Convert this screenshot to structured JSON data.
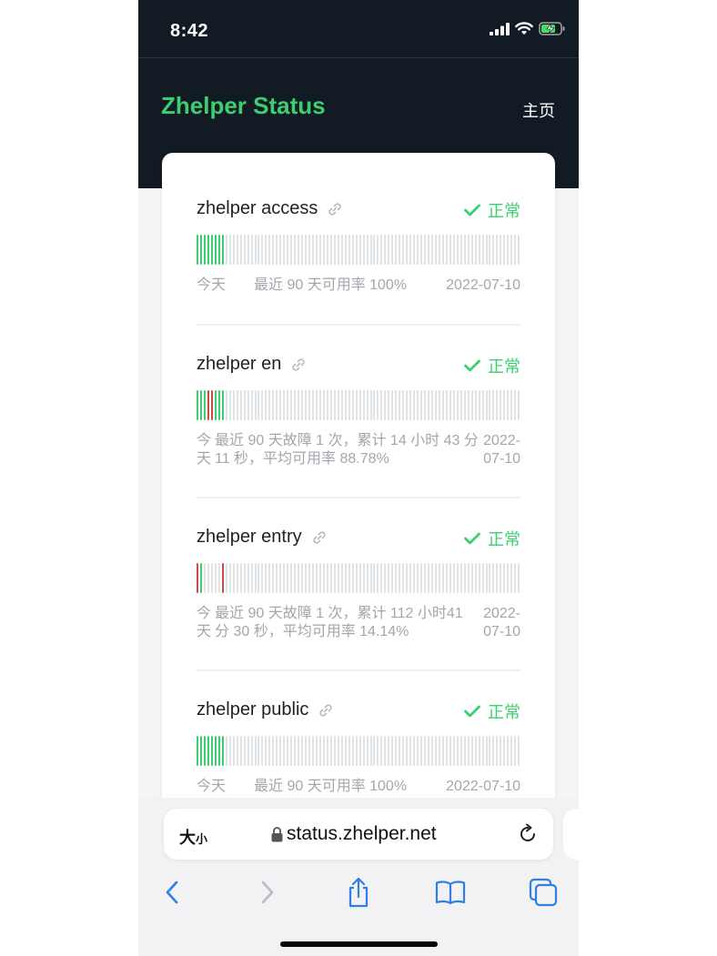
{
  "status_bar": {
    "time": "8:42"
  },
  "header": {
    "title": "Zhelper Status",
    "nav_home": "主页"
  },
  "colors": {
    "up": "#3ccf6f",
    "down": "#c94b4b",
    "empty": "#e0e3e6",
    "header_bg": "#121a24"
  },
  "monitors": [
    {
      "name": "zhelper access",
      "status": "正常",
      "day_states": [
        "up",
        "up",
        "up",
        "up",
        "up",
        "up",
        "up",
        "up"
      ],
      "today_label": "今天",
      "summary": "最近 90 天可用率 100%",
      "date": "2022-07-10"
    },
    {
      "name": "zhelper en",
      "status": "正常",
      "day_states": [
        "up",
        "up",
        "up",
        "down",
        "down",
        "up",
        "up",
        "up"
      ],
      "today_label": "今天",
      "summary": "最近 90 天故障 1 次，累计 14 小时 43 分 11 秒，平均可用率 88.78%",
      "date": "2022-07-10"
    },
    {
      "name": "zhelper entry",
      "status": "正常",
      "day_states": [
        "down",
        "up",
        "empty",
        "empty",
        "empty",
        "empty",
        "empty",
        "down"
      ],
      "today_label": "今天",
      "summary": "最近 90 天故障 1 次，累计 112 小时41 分 30 秒，平均可用率 14.14%",
      "date": "2022-07-10"
    },
    {
      "name": "zhelper public",
      "status": "正常",
      "day_states": [
        "up",
        "up",
        "up",
        "up",
        "up",
        "up",
        "up",
        "up"
      ],
      "today_label": "今天",
      "summary": "最近 90 天可用率 100%",
      "date": "2022-07-10"
    }
  ],
  "browser": {
    "text_size_big": "大",
    "text_size_small": "小",
    "url": "status.zhelper.net"
  },
  "icons": {
    "link": "link-icon",
    "status_ok": "check-icon",
    "lock": "lock-icon",
    "reload": "reload-icon",
    "back": "chevron-left-icon",
    "forward": "chevron-right-icon",
    "share": "share-icon",
    "bookmarks": "book-icon",
    "tabs": "tabs-icon"
  }
}
